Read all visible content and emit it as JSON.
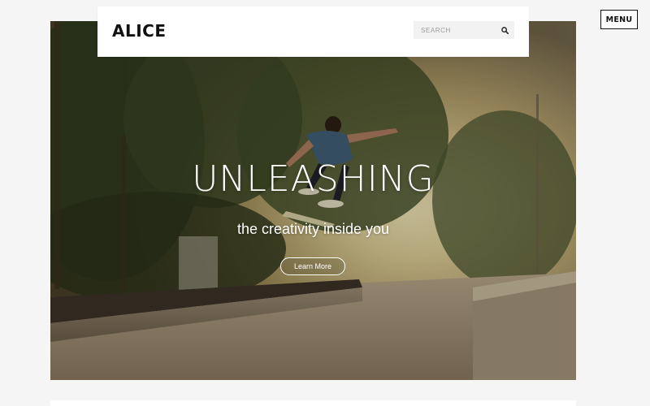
{
  "header": {
    "logo": "ALICE",
    "search": {
      "placeholder": "SEARCH",
      "icon": "search-icon"
    }
  },
  "menu": {
    "label": "MENU"
  },
  "hero": {
    "title": "UNLEASHING",
    "subtitle": "the creativity inside you",
    "cta_label": "Learn More",
    "image": "skateboarder-jump-photo"
  },
  "colors": {
    "background": "#f5f5f5",
    "header_bg": "#ffffff",
    "text_dark": "#111111",
    "hero_text": "#ffffff"
  }
}
